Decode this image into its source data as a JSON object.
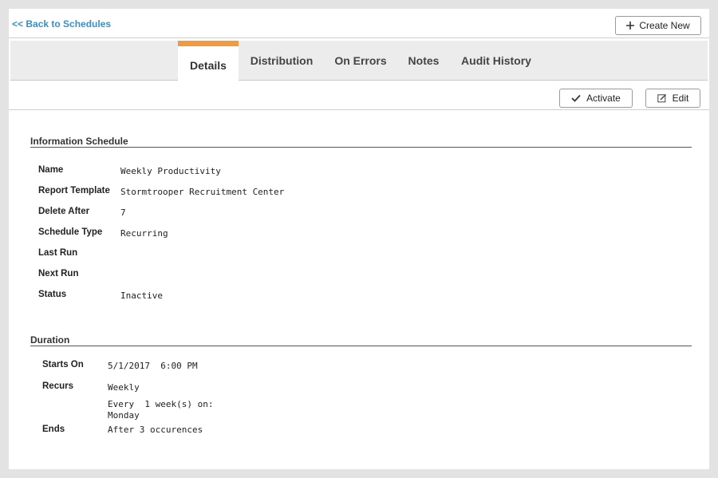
{
  "nav": {
    "back_label": "<< Back to Schedules",
    "create_label": "Create New"
  },
  "tabs": [
    {
      "label": "Details",
      "active": true
    },
    {
      "label": "Distribution",
      "active": false
    },
    {
      "label": "On Errors",
      "active": false
    },
    {
      "label": "Notes",
      "active": false
    },
    {
      "label": "Audit History",
      "active": false
    }
  ],
  "actions": {
    "activate_label": "Activate",
    "edit_label": "Edit"
  },
  "info": {
    "title": "Information Schedule",
    "rows": [
      {
        "label": "Name",
        "value": "Weekly Productivity"
      },
      {
        "label": "Report Template",
        "value": "Stormtrooper Recruitment Center"
      },
      {
        "label": "Delete After",
        "value": "7"
      },
      {
        "label": "Schedule Type",
        "value": "Recurring"
      },
      {
        "label": "Last Run",
        "value": ""
      },
      {
        "label": "Next Run",
        "value": ""
      },
      {
        "label": "Status",
        "value": "Inactive"
      }
    ]
  },
  "duration": {
    "title": "Duration",
    "starts_on_label": "Starts On",
    "starts_on_value": "5/1/2017  6:00 PM",
    "recurs_label": "Recurs",
    "recurs_value": "Weekly",
    "recurs_detail_1": "Every  1 week(s) on:",
    "recurs_detail_2": "Monday",
    "ends_label": "Ends",
    "ends_value": "After 3 occurences"
  },
  "colors": {
    "accent": "#f29a3c",
    "link": "#3a8fc9",
    "background": "#e3e3e3",
    "tabbar": "#ececec"
  },
  "icons": {
    "create": "plus-icon",
    "activate": "check-icon",
    "edit": "edit-icon"
  }
}
